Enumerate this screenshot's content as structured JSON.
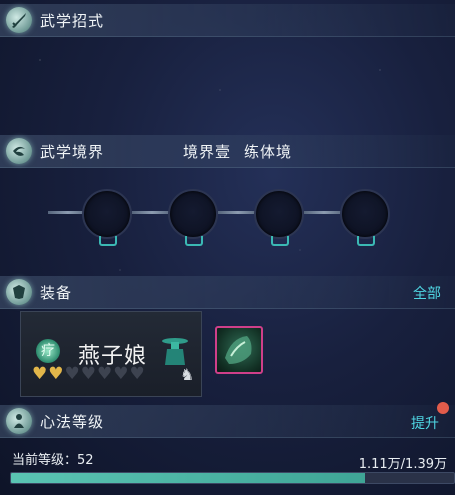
{
  "sections": {
    "moves": {
      "title": "武学招式",
      "icon": "sword-icon"
    },
    "realm": {
      "title": "武学境界",
      "stage": "境界壹",
      "stage_name": "练体境",
      "icon": "swirl-icon",
      "node_count": 4
    },
    "equipment": {
      "title": "装备",
      "all_link": "全部",
      "icon": "armor-icon",
      "item": {
        "name": "燕子娘",
        "symbol": "疗",
        "stars_filled": 2,
        "stars_total": 7
      }
    },
    "mind": {
      "title": "心法等级",
      "upgrade_label": "提升",
      "icon": "figure-icon"
    }
  },
  "level": {
    "label": "当前等级：52",
    "progress_text": "1.11万/1.39万",
    "fraction": 0.7986
  },
  "colors": {
    "accent": "#4fd6e3",
    "gold": "#e2b64a",
    "bar": "#5ac4b3",
    "badge": "#e25c4b"
  }
}
